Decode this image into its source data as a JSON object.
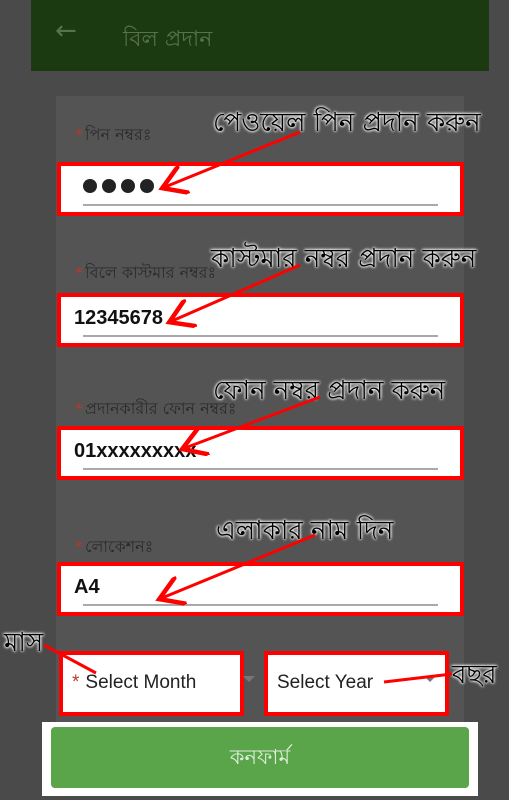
{
  "appbar": {
    "title": "বিল প্রদান"
  },
  "form": {
    "pin": {
      "label": "পিন নম্বরঃ",
      "value_dots": 4
    },
    "customer": {
      "label": "বিলে কাস্টমার নম্বরঃ",
      "value": "12345678"
    },
    "phone": {
      "label": "প্রদানকারীর ফোন নম্বরঃ",
      "value": "01xxxxxxxxx"
    },
    "location": {
      "label": "লোকেশনঃ",
      "value": "A4"
    },
    "month_select": {
      "text": "Select Month",
      "required_mark": "*"
    },
    "year_select": {
      "text": "Select Year"
    },
    "required_mark": "*"
  },
  "confirm_button": {
    "label": "কনফার্ম"
  },
  "annotations": {
    "pin": "পেওয়েল পিন প্রদান করুন",
    "customer": "কাস্টমার নম্বর প্রদান করুন",
    "phone": "ফোন নম্বর প্রদান করুন",
    "location": "এলাকার নাম দিন",
    "month": "মাস",
    "year": "বছর"
  },
  "colors": {
    "highlight": "#ff0000",
    "appbar": "#1b3a12",
    "button": "#5aa54a"
  }
}
